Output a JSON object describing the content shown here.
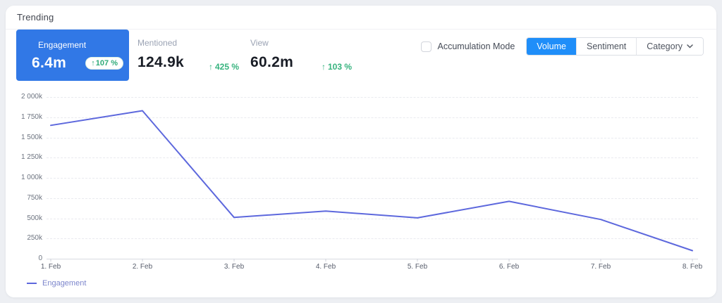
{
  "page_title": "Trending",
  "icons": {
    "arrow_up": "↑",
    "chevron_down": "chevron-down"
  },
  "stats": {
    "engagement": {
      "label": "Engagement",
      "value": "6.4m",
      "delta": "107 %"
    },
    "mentioned": {
      "label": "Mentioned",
      "value": "124.9k",
      "delta": "425 %"
    },
    "view": {
      "label": "View",
      "value": "60.2m",
      "delta": "103 %"
    }
  },
  "controls": {
    "accumulation_mode": {
      "label": "Accumulation Mode",
      "checked": false
    },
    "view_buttons": [
      {
        "label": "Volume",
        "active": true,
        "has_dropdown": false
      },
      {
        "label": "Sentiment",
        "active": false,
        "has_dropdown": false
      },
      {
        "label": "Category",
        "active": false,
        "has_dropdown": true
      }
    ]
  },
  "colors": {
    "page_background": "#edeff3",
    "card_background": "#ffffff",
    "highlight_tile_blue": "#3178e6",
    "active_button_blue": "#1f8ef9",
    "positive_green": "#36b37e",
    "chart_line": "#5d68dd"
  },
  "chart_data": {
    "type": "line",
    "title": "Trending",
    "x": [
      "1. Feb",
      "2. Feb",
      "3. Feb",
      "4. Feb",
      "5. Feb",
      "6. Feb",
      "7. Feb",
      "8. Feb"
    ],
    "series": [
      {
        "name": "Engagement",
        "color": "#5d68dd",
        "values": [
          1650000,
          1830000,
          510000,
          590000,
          505000,
          710000,
          485000,
          100000
        ]
      }
    ],
    "ylim": [
      0,
      2000000
    ],
    "ytick_labels": [
      "2 000k",
      "1 750k",
      "1 500k",
      "1 250k",
      "1 000k",
      "750k",
      "500k",
      "250k",
      "0"
    ],
    "grid": true,
    "legend": [
      "Engagement"
    ],
    "legend_position": "bottom-left"
  }
}
